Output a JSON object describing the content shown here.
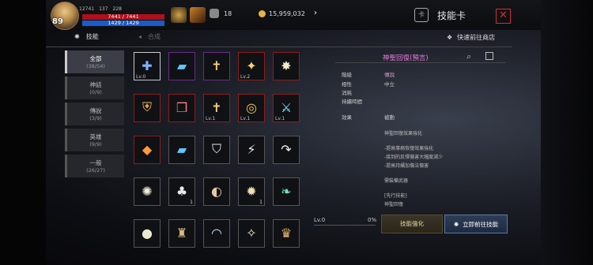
{
  "player": {
    "level": "89",
    "stat1": "12741",
    "stat2": "137",
    "stat3": "228",
    "hp": "7441 / 7441",
    "mp": "1429 / 1429"
  },
  "topbar": {
    "count": "18",
    "gold": "15,959,032"
  },
  "window": {
    "title": "技能卡"
  },
  "tabs": [
    {
      "label": "技能"
    },
    {
      "label": "合成"
    }
  ],
  "shop_link": "快速前往商店",
  "filters": [
    {
      "name": "全部",
      "count": "(38/54)"
    },
    {
      "name": "神話",
      "count": "(0/9)"
    },
    {
      "name": "傳說",
      "count": "(3/9)"
    },
    {
      "name": "英雄",
      "count": "(9/9)"
    },
    {
      "name": "一般",
      "count": "(26/27)"
    }
  ],
  "grid": [
    {
      "icon": "shield-cross-icon",
      "lv": "Lv.0",
      "cnt": ""
    },
    {
      "icon": "book-icon",
      "lv": "",
      "cnt": ""
    },
    {
      "icon": "holy-book-icon",
      "lv": "",
      "cnt": ""
    },
    {
      "icon": "holy-orb-icon",
      "lv": "Lv.2",
      "cnt": ""
    },
    {
      "icon": "holy-burst-icon",
      "lv": "",
      "cnt": ""
    },
    {
      "icon": "shield-fire-icon",
      "lv": "",
      "cnt": ""
    },
    {
      "icon": "red-book-icon",
      "lv": "",
      "cnt": ""
    },
    {
      "icon": "holy-book-icon",
      "lv": "Lv.1",
      "cnt": ""
    },
    {
      "icon": "swirl-icon",
      "lv": "Lv.1",
      "cnt": ""
    },
    {
      "icon": "sword-icon",
      "lv": "Lv.1",
      "cnt": ""
    },
    {
      "icon": "exp-icon",
      "lv": "",
      "cnt": ""
    },
    {
      "icon": "book-icon",
      "lv": "",
      "cnt": ""
    },
    {
      "icon": "shield-icon",
      "lv": "",
      "cnt": ""
    },
    {
      "icon": "lightning-icon",
      "lv": "",
      "cnt": ""
    },
    {
      "icon": "curve-arrow-icon",
      "lv": "",
      "cnt": ""
    },
    {
      "icon": "starburst-icon",
      "lv": "",
      "cnt": ""
    },
    {
      "icon": "bell-icon",
      "lv": "",
      "cnt": "1"
    },
    {
      "icon": "eye-icon",
      "lv": "",
      "cnt": ""
    },
    {
      "icon": "gear-icon",
      "lv": "",
      "cnt": "1"
    },
    {
      "icon": "leaf-icon",
      "lv": "",
      "cnt": ""
    },
    {
      "icon": "orb-icon",
      "lv": "",
      "cnt": ""
    },
    {
      "icon": "helmet-icon",
      "lv": "",
      "cnt": ""
    },
    {
      "icon": "arc-icon",
      "lv": "",
      "cnt": ""
    },
    {
      "icon": "sparkle-icon",
      "lv": "",
      "cnt": ""
    },
    {
      "icon": "crown-icon",
      "lv": "",
      "cnt": ""
    }
  ],
  "detail": {
    "title": "神聖回復(預言)",
    "grade_label": "階級",
    "grade": "傳說",
    "attr_label": "相性",
    "attr": "中立",
    "cost_label": "消耗",
    "duration_label": "持續時間",
    "effect_label": "效果",
    "effect": "被動",
    "desc": [
      "神聖回復效果強化",
      "-提高事務恢復效果強化",
      "-接到的反彈傷害大幅度減少",
      "-提高持續加傷法傷害",
      "需裝備武器",
      "[先行技能]",
      "神聖回復"
    ],
    "level": "Lv.0",
    "progress": "0%"
  },
  "buttons": {
    "enhance": "技能強化",
    "goto": "立即前往技能"
  }
}
